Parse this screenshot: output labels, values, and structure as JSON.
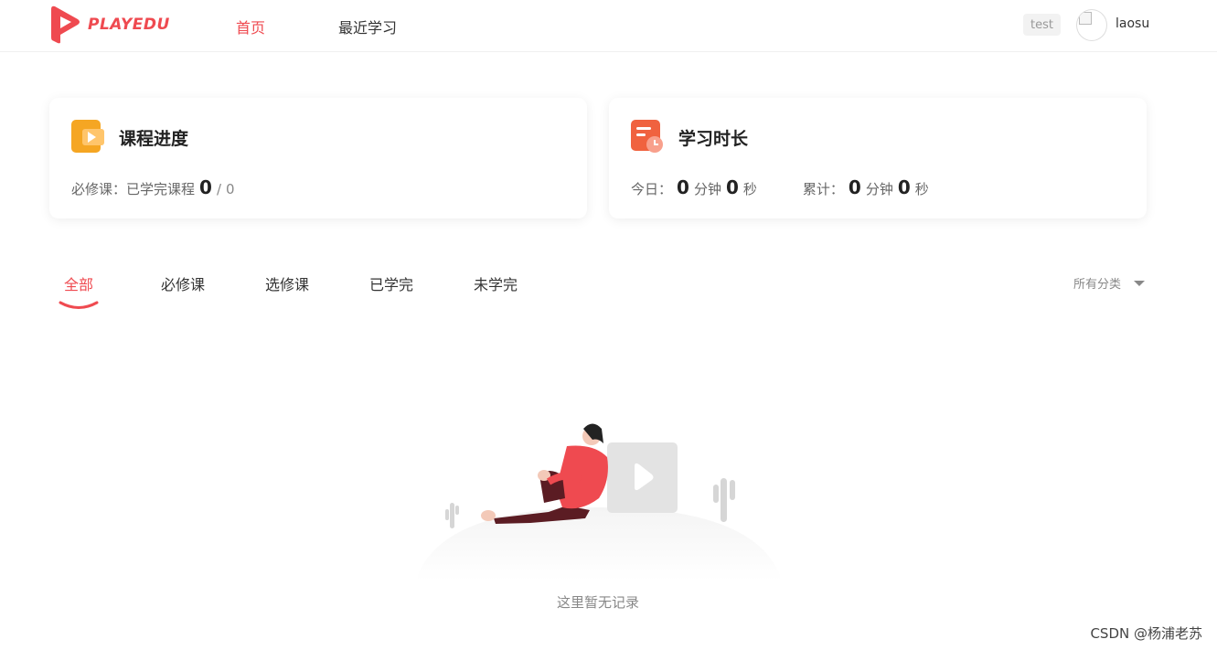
{
  "header": {
    "logo_text": "PLAYEDU",
    "nav": [
      {
        "label": "首页",
        "active": true
      },
      {
        "label": "最近学习",
        "active": false
      }
    ],
    "badge": "test",
    "username": "laosu"
  },
  "progress_card": {
    "title": "课程进度",
    "label": "必修课：已学完课程",
    "done": "0",
    "separator": "/",
    "total": "0"
  },
  "time_card": {
    "title": "学习时长",
    "today_label": "今日：",
    "today_min": "0",
    "today_min_unit": "分钟",
    "today_sec": "0",
    "today_sec_unit": "秒",
    "total_label": "累计：",
    "total_min": "0",
    "total_min_unit": "分钟",
    "total_sec": "0",
    "total_sec_unit": "秒"
  },
  "tabs": [
    {
      "label": "全部",
      "active": true
    },
    {
      "label": "必修课",
      "active": false
    },
    {
      "label": "选修课",
      "active": false
    },
    {
      "label": "已学完",
      "active": false
    },
    {
      "label": "未学完",
      "active": false
    }
  ],
  "filter": {
    "label": "所有分类",
    "icon": "caret-down-icon"
  },
  "empty": {
    "text": "这里暂无记录"
  },
  "watermark": "CSDN @杨浦老苏",
  "colors": {
    "accent": "#ef4a50",
    "orange": "#f5a623"
  }
}
